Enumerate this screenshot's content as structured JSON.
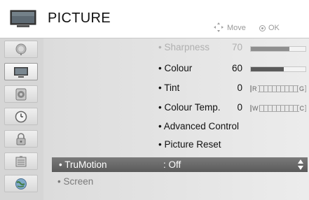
{
  "header": {
    "title": "PICTURE",
    "hint_move": "Move",
    "hint_ok": "OK"
  },
  "sidebar": {
    "items": [
      {
        "name": "satellite-dish-icon"
      },
      {
        "name": "tv-picture-icon",
        "active": true
      },
      {
        "name": "speaker-icon"
      },
      {
        "name": "clock-icon"
      },
      {
        "name": "lock-icon"
      },
      {
        "name": "options-box-icon"
      },
      {
        "name": "network-globe-icon"
      }
    ]
  },
  "submenu": {
    "sharpness": {
      "label": "• Sharpness",
      "value": "70",
      "level": 70
    },
    "colour": {
      "label": "• Colour",
      "value": "60",
      "level": 60
    },
    "tint": {
      "label": "• Tint",
      "value": "0",
      "left": "R",
      "right": "G"
    },
    "colour_temp": {
      "label": "• Colour Temp.",
      "value": "0",
      "left": "W",
      "right": "C"
    },
    "advanced": {
      "label": "• Advanced Control"
    },
    "reset": {
      "label": "• Picture Reset"
    }
  },
  "main": {
    "selected": {
      "label": "• TruMotion",
      "value": ": Off"
    },
    "screen": {
      "label": "• Screen"
    }
  },
  "colors": {
    "highlight": "#6a6a6a",
    "bar_fill": "#5a5a5a"
  }
}
